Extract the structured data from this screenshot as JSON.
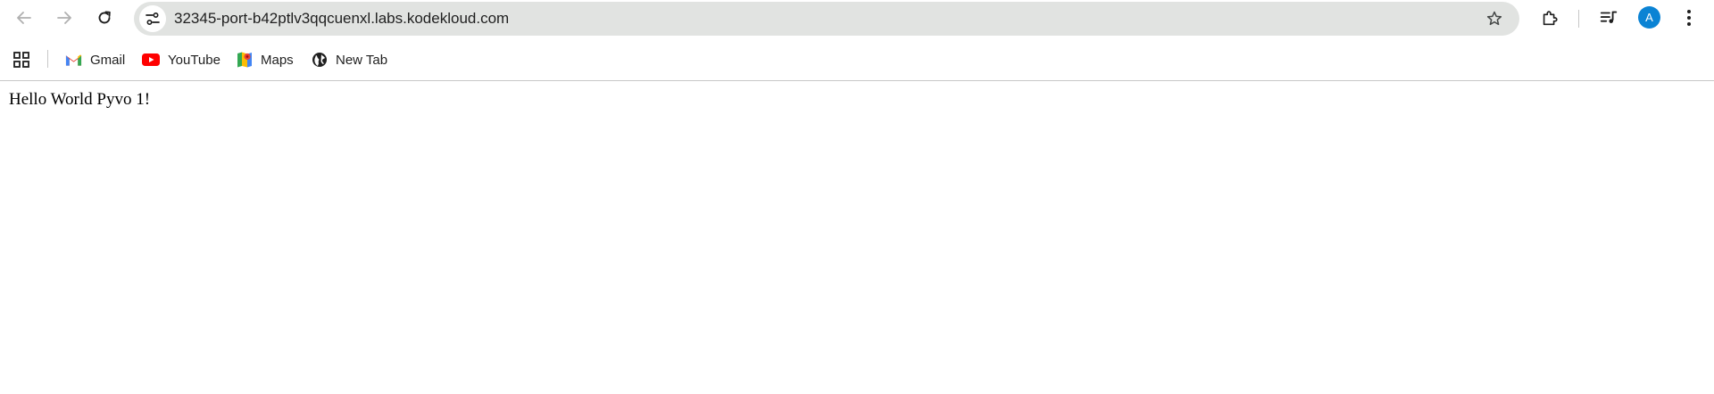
{
  "browser": {
    "url": "32345-port-b42ptlv3qqcuenxl.labs.kodekloud.com",
    "profile_initial": "A",
    "nav_icons": [
      "back-arrow-icon",
      "forward-arrow-icon",
      "reload-icon"
    ],
    "right_icons": [
      "star-icon",
      "extensions-icon",
      "media-controls-icon",
      "kebab-menu-icon"
    ],
    "accent_color": "#0b83d4"
  },
  "bookmarks": {
    "items": [
      {
        "label": "Gmail",
        "icon": "gmail-icon"
      },
      {
        "label": "YouTube",
        "icon": "youtube-icon"
      },
      {
        "label": "Maps",
        "icon": "maps-icon"
      },
      {
        "label": "New Tab",
        "icon": "globe-icon"
      }
    ]
  },
  "page": {
    "body_text": "Hello World Pyvo 1!"
  }
}
